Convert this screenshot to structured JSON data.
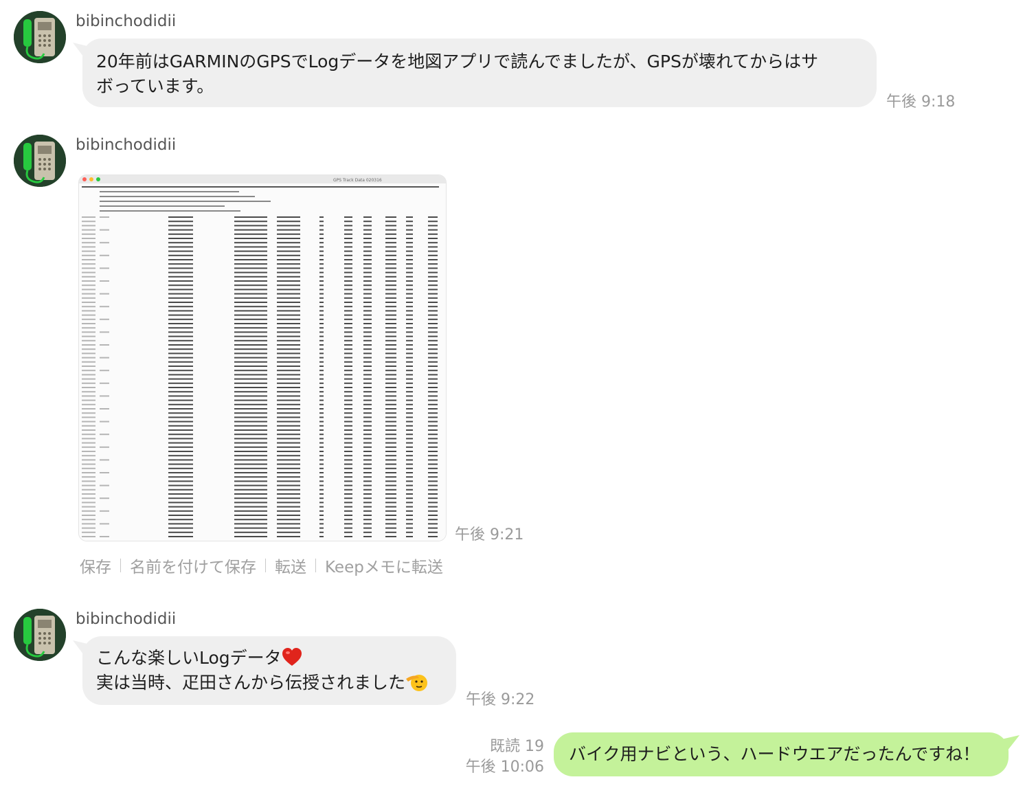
{
  "messages": [
    {
      "sender": "bibinchodidii",
      "line1": "20年前はGARMINのGPSでLogデータを地図アプリで読んでましたが、GPSが壊れてからはサ",
      "line2": "ボっています。",
      "time": "午後 9:18"
    },
    {
      "sender": "bibinchodidii",
      "image_title": "GPS Track Data 020316",
      "image_desc": "GPS track data spreadsheet screenshot",
      "time": "午後 9:21",
      "actions": [
        "保存",
        "名前を付けて保存",
        "転送",
        "Keepメモに転送"
      ]
    },
    {
      "sender": "bibinchodidii",
      "line1": "こんな楽しいLogデータ",
      "line2": "実は当時、疋田さんから伝授されました",
      "time": "午後 9:22",
      "emoji1": "heart-emoji",
      "emoji2": "saluting-face-emoji"
    },
    {
      "text": "バイク用ナビという、ハードウエアだったんですね！",
      "read": "既読 19",
      "time": "午後 10:06"
    }
  ],
  "colors": {
    "incoming_bubble": "#efefef",
    "outgoing_bubble": "#c4f29a",
    "meta_text": "#9a9a9a"
  }
}
